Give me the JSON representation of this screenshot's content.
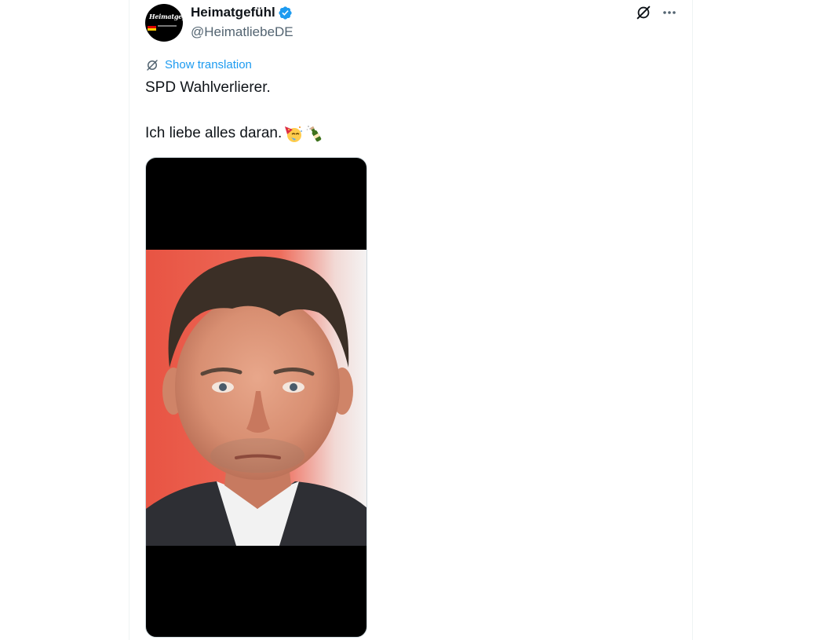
{
  "tweet": {
    "author_name": "Heimatgefühl",
    "author_handle": "@HeimatliebeDE",
    "avatar_logo_text": "Heimatgefühl",
    "show_translation_label": "Show translation",
    "text_line_1": "SPD Wahlverlierer.",
    "text_line_2": "Ich liebe alles daran.",
    "emojis": [
      "partying-face-emoji",
      "champagne-bottle-emoji"
    ],
    "media_alt": "Photo of a man in a dark suit jacket and white shirt against a red background"
  },
  "icons": {
    "verified": "verified-badge-icon",
    "grok": "grok-icon",
    "more": "more-icon",
    "translate": "translate-icon"
  },
  "colors": {
    "accent": "#1d9bf0",
    "text": "#0f1419",
    "secondary_text": "#536471",
    "divider": "#eff3f4"
  }
}
